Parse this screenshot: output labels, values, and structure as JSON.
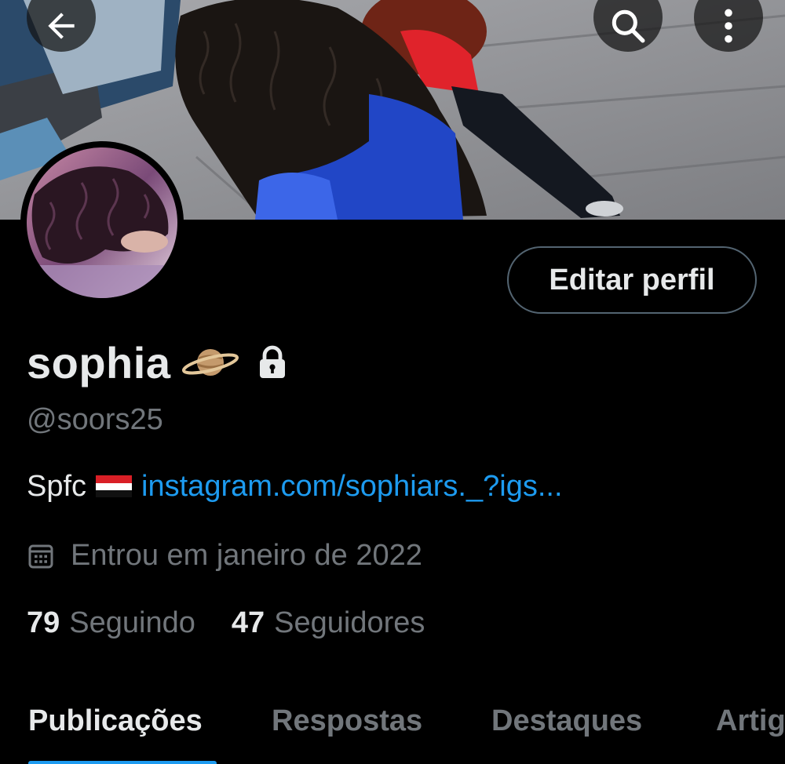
{
  "header": {
    "back_icon": "arrow-left-icon",
    "search_icon": "search-icon",
    "more_icon": "more-vertical-icon"
  },
  "profile": {
    "display_name": "sophia",
    "name_emoji": "ringed-planet-emoji",
    "protected_icon": "lock-icon",
    "handle": "@soors25",
    "bio_text": "Spfc",
    "bio_flag": "yemen-flag-emoji",
    "bio_link": "instagram.com/sophiars._?igs...",
    "joined": "Entrou em janeiro de 2022",
    "edit_button_label": "Editar perfil"
  },
  "counts": {
    "following_count": "79",
    "following_label": "Seguindo",
    "followers_count": "47",
    "followers_label": "Seguidores"
  },
  "tabs": [
    {
      "label": "Publicações",
      "active": true
    },
    {
      "label": "Respostas",
      "active": false
    },
    {
      "label": "Destaques",
      "active": false
    },
    {
      "label": "Artigos",
      "active": false
    }
  ],
  "colors": {
    "background": "#000000",
    "text_primary": "#e7e9ea",
    "text_secondary": "#71767b",
    "link": "#1d9bf0",
    "button_border": "#536471"
  }
}
